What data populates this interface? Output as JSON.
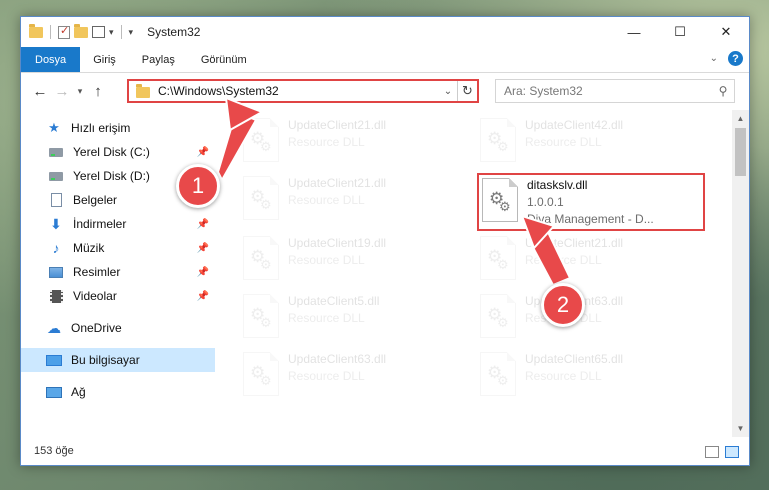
{
  "window": {
    "title": "System32",
    "controls": {
      "minimize": "—",
      "maximize": "☐",
      "close": "✕"
    }
  },
  "ribbon": {
    "tabs": [
      "Dosya",
      "Giriş",
      "Paylaş",
      "Görünüm"
    ],
    "active_tab": "Dosya",
    "help": "?"
  },
  "address": {
    "path": "C:\\Windows\\System32",
    "search_placeholder": "Ara: System32"
  },
  "nav_pane": {
    "quick_access": "Hızlı erişim",
    "items": [
      {
        "label": "Yerel Disk (C:)",
        "icon": "drive-icon",
        "pinned": true
      },
      {
        "label": "Yerel Disk (D:)",
        "icon": "drive-icon",
        "pinned": false
      },
      {
        "label": "Belgeler",
        "icon": "documents-icon",
        "pinned": true
      },
      {
        "label": "İndirmeler",
        "icon": "download-icon",
        "pinned": true
      },
      {
        "label": "Müzik",
        "icon": "music-icon",
        "pinned": true
      },
      {
        "label": "Resimler",
        "icon": "pictures-icon",
        "pinned": true
      },
      {
        "label": "Videolar",
        "icon": "videos-icon",
        "pinned": true
      }
    ],
    "onedrive": "OneDrive",
    "this_pc": "Bu bilgisayar",
    "network": "Ağ"
  },
  "files": {
    "left_column": [
      {
        "name": "UpdateClient21.dll",
        "desc": "Resource DLL"
      },
      {
        "name": "UpdateClient21.dll",
        "desc": "Resource DLL"
      },
      {
        "name": "UpdateClient19.dll",
        "desc": "Resource DLL"
      },
      {
        "name": "UpdateClient5.dll",
        "desc": "Resource DLL"
      },
      {
        "name": "UpdateClient63.dll",
        "desc": "Resource DLL"
      }
    ],
    "right_column": [
      {
        "name": "UpdateClient42.dll",
        "desc": "Resource DLL"
      },
      {
        "name": "UpdateClient21.dll",
        "desc": "Resource DLL"
      },
      {
        "name": "UpdateClient63.dll",
        "desc": "Resource DLL"
      },
      {
        "name": "UpdateClient65.dll",
        "desc": "Resource DLL"
      }
    ],
    "highlighted": {
      "name": "ditaskslv.dll",
      "version": "1.0.0.1",
      "company": "Diva Management - D..."
    }
  },
  "status": {
    "item_count": "153 öğe"
  },
  "annotations": {
    "step1": "1",
    "step2": "2"
  },
  "colors": {
    "accent": "#1979ca",
    "highlight": "#e04444",
    "badge": "#e8494a"
  }
}
